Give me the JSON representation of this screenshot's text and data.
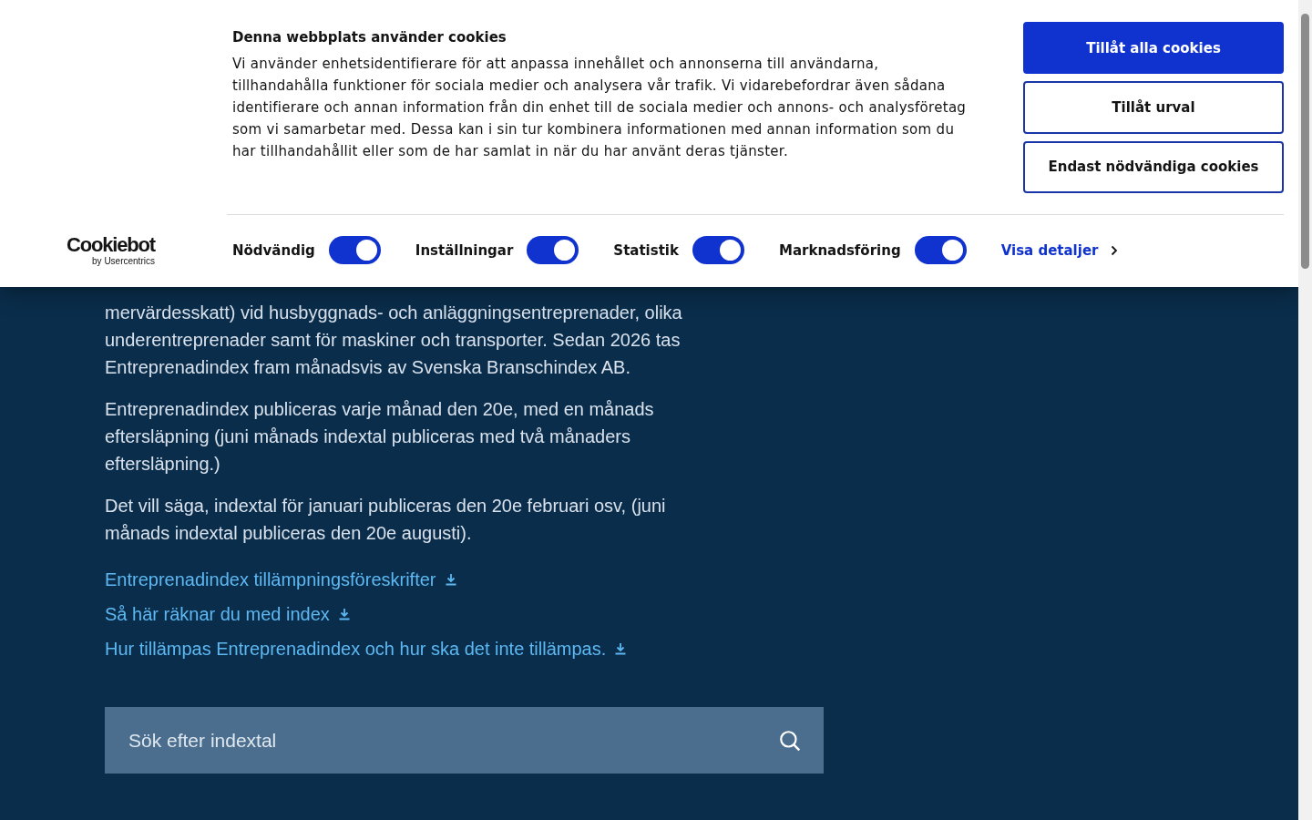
{
  "page": {
    "paragraphs": [
      "mervärdesskatt) vid husbyggnads- och anläggningsentreprenader, olika underentreprenader samt för maskiner och transporter. Sedan 2026 tas Entreprenadindex fram månadsvis av Svenska Branschindex AB.",
      "Entreprenadindex publiceras varje månad den 20e, med en månads eftersläpning (juni månads indextal publiceras med två månaders eftersläpning.)",
      "Det vill säga, indextal för januari publiceras den 20e februari osv, (juni månads indextal publiceras den 20e augusti)."
    ],
    "links": [
      "Entreprenadindex tillämpningsföreskrifter",
      "Så här räknar du med index",
      "Hur tillämpas Entreprenadindex och hur ska det inte tillämpas."
    ],
    "search": {
      "placeholder": "Sök efter indextal"
    }
  },
  "cookie_banner": {
    "title": "Denna webbplats använder cookies",
    "text": "Vi använder enhetsidentifierare för att anpassa innehållet och annonserna till användarna, tillhandahålla funktioner för sociala medier och analysera vår trafik. Vi vidarebefordrar även sådana identifierare och annan information från din enhet till de sociala medier och annons- och analysföretag som vi samarbetar med. Dessa kan i sin tur kombinera informationen med annan information som du har tillhandahållit eller som de har samlat in när du har använt deras tjänster.",
    "buttons": [
      {
        "label": "Tillåt alla cookies",
        "kind": "primary"
      },
      {
        "label": "Tillåt urval",
        "kind": "outline"
      },
      {
        "label": "Endast nödvändiga cookies",
        "kind": "outline"
      }
    ],
    "logo": {
      "name": "Cookiebot",
      "byline": "by Usercentrics"
    },
    "categories": [
      {
        "label": "Nödvändig",
        "on": true
      },
      {
        "label": "Inställningar",
        "on": true
      },
      {
        "label": "Statistik",
        "on": true
      },
      {
        "label": "Marknadsföring",
        "on": true
      }
    ],
    "details_link": "Visa detaljer"
  }
}
